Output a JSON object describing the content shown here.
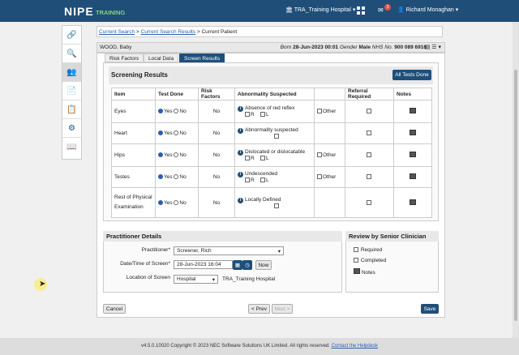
{
  "header": {
    "brand": "NIPE",
    "brand_sub": "TRAINING",
    "site": "TRA_Training Hospital",
    "mail_badge": "3",
    "user": "Richard Monaghan"
  },
  "breadcrumb": {
    "current_search": "Current Search",
    "search_results": "Current Search Results",
    "current_patient": "Current Patient",
    "sep1": " > ",
    "sep2": " > "
  },
  "patient": {
    "name": "WOOD, Baby",
    "born_label": "Born",
    "born": "28-Jun-2023 00:01",
    "gender_label": "Gender",
    "gender": "Male",
    "nhs_label": "NHS No.",
    "nhs": "900 089 6916"
  },
  "tabs": [
    "Risk Factors",
    "Local Data",
    "Screen Results"
  ],
  "screening": {
    "title": "Screening Results",
    "all_done": "All Tests Done",
    "columns": [
      "Item",
      "Test Done",
      "Risk Factors",
      "Abnormality Suspected",
      "Referral Required",
      "Notes"
    ],
    "yes": "Yes",
    "no": "No",
    "r": "R",
    "l": "L",
    "other": "Other",
    "rows": [
      {
        "item": "Eyes",
        "risk": "No",
        "abnormality": "Absence of red reflex"
      },
      {
        "item": "Heart",
        "risk": "No",
        "abnormality": "Abnormality suspected"
      },
      {
        "item": "Hips",
        "risk": "No",
        "abnormality": "Dislocated or dislocatable"
      },
      {
        "item": "Testes",
        "risk": "No",
        "abnormality": "Undescended"
      },
      {
        "item": "Rest of Physical Examination",
        "risk": "No",
        "abnormality": "Locally Defined"
      }
    ]
  },
  "practitioner": {
    "title": "Practitioner Details",
    "practitioner_label": "Practitioner*",
    "practitioner_value": "Screener, Rich",
    "datetime_label": "Date/Time of Screen*",
    "datetime_value": "28-Jun-2023 16:04",
    "now": "Now",
    "location_label": "Location of Screen",
    "location_value": "Hospital",
    "location_site": "TRA_Training Hospital"
  },
  "review": {
    "title": "Review by Senior Clinician",
    "required": "Required",
    "completed": "Completed",
    "notes": "Notes"
  },
  "buttons": {
    "cancel": "Cancel",
    "prev": "< Prev",
    "next": "Next >",
    "save": "Save"
  },
  "footer": {
    "text": "v4.5.0.10020 Copyright © 2023 NEC Software Solutions UK Limited. All rights reserved.",
    "helpdesk": "Contact the Helpdesk"
  }
}
